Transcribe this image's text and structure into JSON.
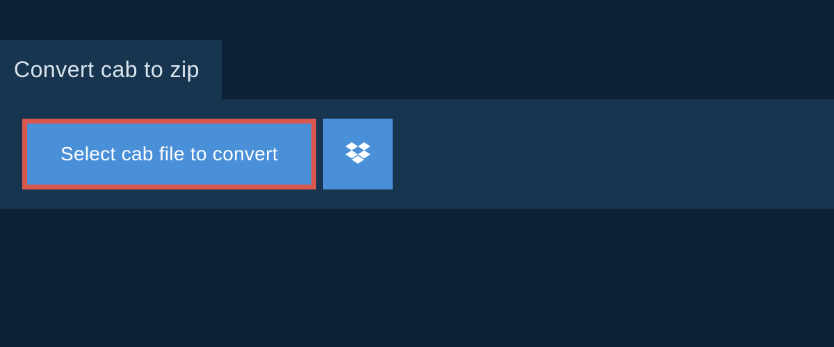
{
  "header": {
    "title": "Convert cab to zip"
  },
  "actions": {
    "select_file_label": "Select cab file to convert",
    "dropbox_icon_name": "dropbox-icon"
  },
  "colors": {
    "background": "#0d2238",
    "panel": "#17354f",
    "button": "#4a90d9",
    "highlight_border": "#d9574c",
    "text_light": "#d9e4ed",
    "text_white": "#ffffff"
  }
}
